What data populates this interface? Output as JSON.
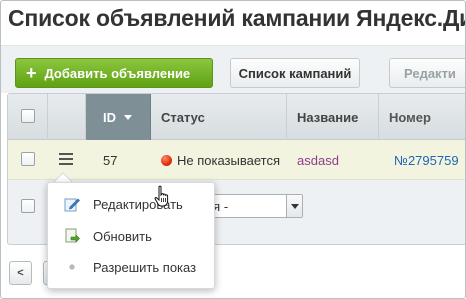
{
  "page": {
    "title": "Список объявлений кампании Яндекс.Ди"
  },
  "toolbar": {
    "add_label": "Добавить объявление",
    "campaigns_label": "Список кампаний",
    "edit_label": "Редакти"
  },
  "table": {
    "columns": [
      "ID",
      "Статус",
      "Название",
      "Номер"
    ],
    "row": {
      "id": "57",
      "status": "Не показывается",
      "name": "asdasd",
      "number": "№2795759"
    }
  },
  "footer": {
    "action_select_value": "вия -"
  },
  "context_menu": {
    "items": [
      {
        "label": "Редактировать",
        "icon": "pencil-icon"
      },
      {
        "label": "Обновить",
        "icon": "refresh-document-icon"
      },
      {
        "label": "Разрешить показ",
        "icon": "bullet-dot-icon"
      }
    ]
  },
  "pager": {
    "prev_label": "<"
  },
  "colors": {
    "accent_green": "#6fb01f",
    "status_red": "#e0300d",
    "link_blue": "#2067b0",
    "name_purple": "#8b3f8e",
    "row_highlight": "#f2f4e0",
    "sorted_header": "#7f8f96"
  }
}
